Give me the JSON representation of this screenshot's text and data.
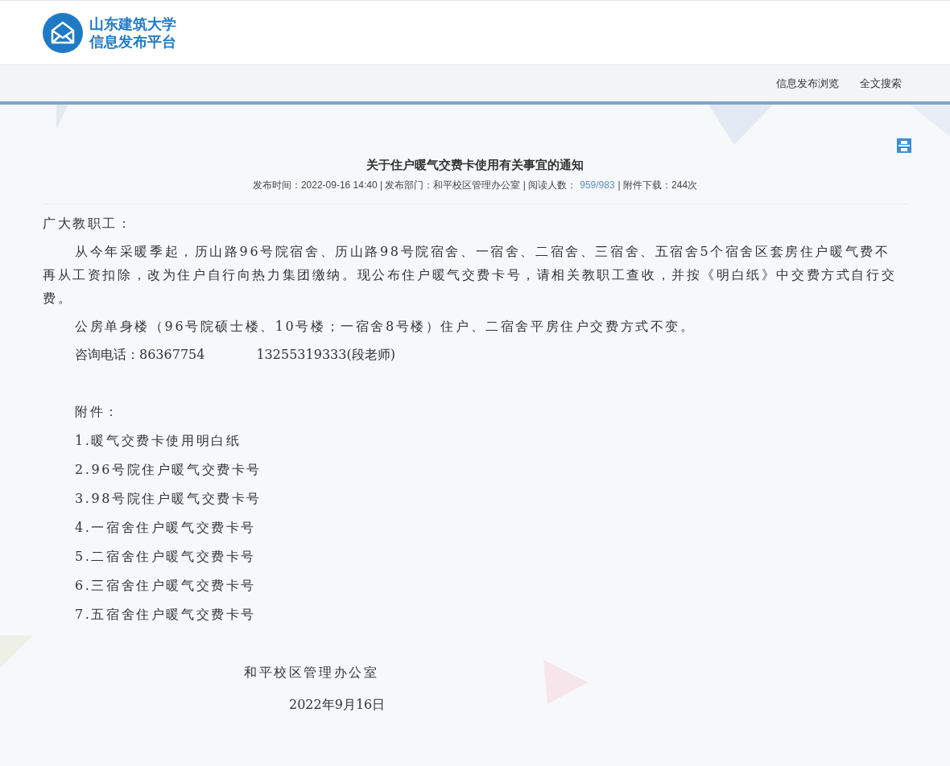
{
  "logo": {
    "line1": "山东建筑大学",
    "line2": "信息发布平台"
  },
  "nav": [
    {
      "label": "信息发布浏览"
    },
    {
      "label": "全文搜索"
    }
  ],
  "article": {
    "title": "关于住户暖气交费卡使用有关事宜的通知",
    "meta": [
      {
        "kind": "text",
        "text": "发布时间：2022-09-16 14:40 | 发布部门：和平校区管理办公室 | 阅读人数："
      },
      {
        "kind": "count",
        "text": "959/983"
      },
      {
        "kind": "text",
        "text": "| 附件下载：244次"
      }
    ],
    "greeting": "广大教职工：",
    "paragraphs": [
      "从今年采暖季起，历山路96号院宿舍、历山路98号院宿舍、一宿舍、二宿舍、三宿舍、五宿舍5个宿舍区套房住户暖气费不再从工资扣除，改为住户自行向热力集团缴纳。现公布住户暖气交费卡号，请相关教职工查收，并按《明白纸》中交费方式自行交费。",
      "公房单身楼（96号院硕士楼、10号楼；一宿舍8号楼）住户、二宿舍平房住户交费方式不变。"
    ],
    "contact": {
      "label": "咨询电话：86367754",
      "mobile": "13255319333(段老师)"
    },
    "attachments_label": "附件：",
    "attachments": [
      "1.暖气交费卡使用明白纸",
      "2.96号院住户暖气交费卡号",
      "3.98号院住户暖气交费卡号",
      "4.一宿舍住户暖气交费卡号",
      "5.二宿舍住户暖气交费卡号",
      "6.三宿舍住户暖气交费卡号",
      "7.五宿舍住户暖气交费卡号"
    ],
    "signature": "和平校区管理办公室",
    "date": "2022年9月16日"
  }
}
